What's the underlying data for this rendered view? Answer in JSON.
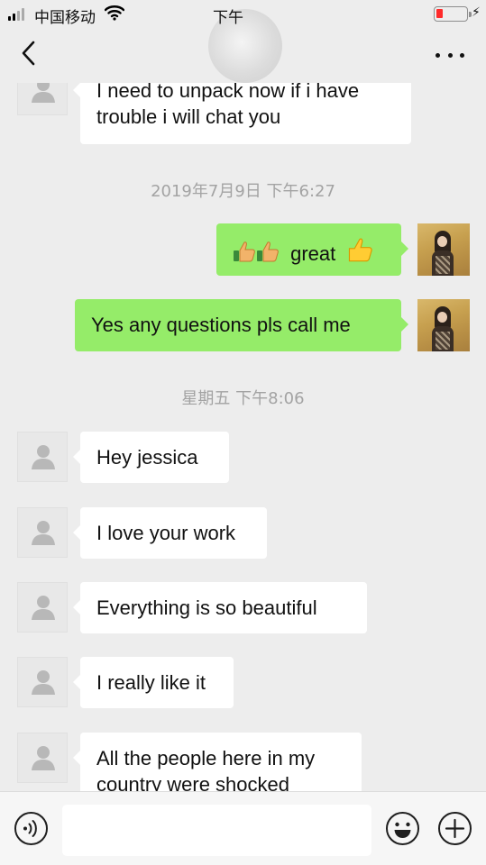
{
  "status_bar": {
    "carrier": "中国移动",
    "time": "下午",
    "battery_level_percent": 10,
    "battery_color": "#ff2b2b"
  },
  "nav": {
    "back_icon": "chevron-left-icon",
    "more_icon": "ellipsis-icon"
  },
  "messages": {
    "m0": {
      "text": "I need to unpack now if i have\ntrouble i will chat you"
    },
    "t1": {
      "text": "2019年7月9日 下午6:27"
    },
    "m1": {
      "text": "great"
    },
    "m2": {
      "text": "Yes any questions pls call me"
    },
    "t2": {
      "text": "星期五 下午8:06"
    },
    "m3": {
      "text": "Hey jessica"
    },
    "m4": {
      "text": "I love your work"
    },
    "m5": {
      "text": "Everything is so beautiful"
    },
    "m6": {
      "text": "I really like it"
    },
    "m7": {
      "text": "All the people here in my\ncountry were shocked"
    }
  },
  "input_bar": {
    "voice_icon": "voice-icon",
    "emoji_icon": "emoji-icon",
    "plus_icon": "plus-icon",
    "value": ""
  },
  "colors": {
    "background": "#ededed",
    "incoming_bubble": "#ffffff",
    "outgoing_bubble": "#95ec69",
    "timestamp_text": "#a3a3a3"
  }
}
